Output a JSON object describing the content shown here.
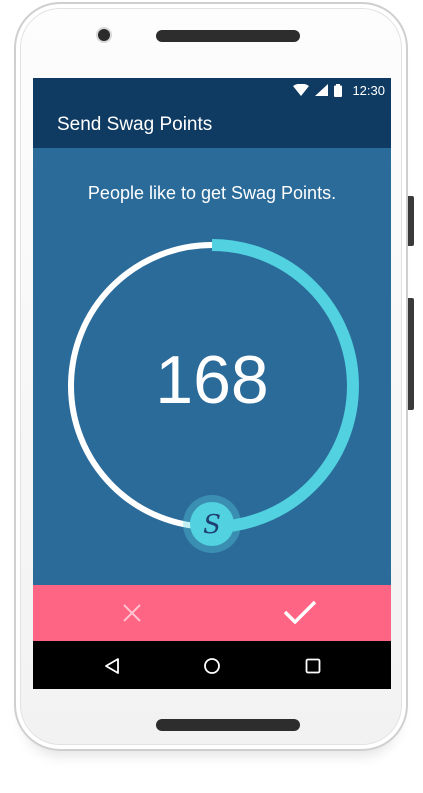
{
  "status_bar": {
    "time": "12:30",
    "icons": [
      "wifi-icon",
      "cellular-signal-icon",
      "battery-icon"
    ]
  },
  "app_bar": {
    "title": "Send Swag Points"
  },
  "main": {
    "prompt": "People like to get Swag Points.",
    "points_value": "168",
    "dial_fraction": 0.5,
    "handle_label": "S"
  },
  "actions": {
    "cancel_icon": "close-icon",
    "confirm_icon": "check-icon"
  },
  "nav_bar": {
    "buttons": [
      "back-icon",
      "home-icon",
      "recents-icon"
    ]
  },
  "colors": {
    "status_bar": "#0f3b63",
    "background": "#2b6b9a",
    "arc_progress": "#52d2e0",
    "arc_track": "#ffffff",
    "action_bar": "#fe6483",
    "nav_bar": "#000000"
  }
}
